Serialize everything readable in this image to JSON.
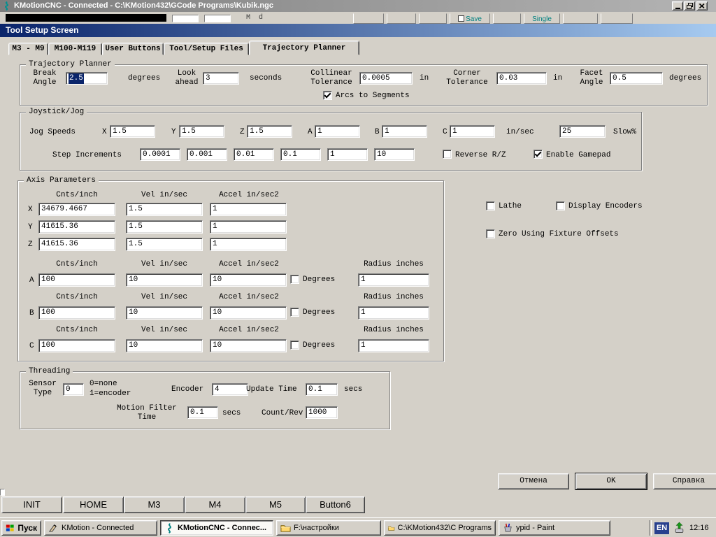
{
  "colors": {
    "face": "#d4d0c8",
    "selection": "#0a246a",
    "titlebar_active_start": "#0a246a",
    "titlebar_active_end": "#a6caf0",
    "teal_accent": "#008080",
    "lang_badge": "#28408e"
  },
  "window": {
    "title": "KMotionCNC - Connected - C:\\KMotion432\\GCode Programs\\Kubik.ngc"
  },
  "strip": {
    "machine_fragment": "M  d",
    "buttons": [
      {
        "label": ""
      },
      {
        "label": ""
      },
      {
        "label": ""
      },
      {
        "label": "Save"
      },
      {
        "label": ""
      },
      {
        "label": "Single"
      },
      {
        "label": ""
      },
      {
        "label": ""
      }
    ]
  },
  "dialog": {
    "title": "Tool Setup Screen",
    "tabs": [
      {
        "label": "M3 - M9"
      },
      {
        "label": "M100-M119"
      },
      {
        "label": "User Buttons"
      },
      {
        "label": "Tool/Setup Files"
      },
      {
        "label": "Trajectory Planner"
      }
    ],
    "trajectory": {
      "group_label": "Trajectory Planner",
      "break_angle": {
        "l1": "Break",
        "l2": "Angle",
        "value": "2.5",
        "unit": "degrees"
      },
      "look_ahead": {
        "l1": "Look",
        "l2": "ahead",
        "value": "3",
        "unit": "seconds"
      },
      "collinear": {
        "l1": "Collinear",
        "l2": "Tolerance",
        "value": "0.0005",
        "unit": "in"
      },
      "corner": {
        "l1": "Corner",
        "l2": "Tolerance",
        "value": "0.03",
        "unit": "in"
      },
      "facet": {
        "l1": "Facet",
        "l2": "Angle",
        "value": "0.5",
        "unit": "degrees"
      },
      "arcs_label": "Arcs to Segments"
    },
    "joystick": {
      "group_label": "Joystick/Jog",
      "jog_label": "Jog Speeds",
      "axes": [
        {
          "axis": "X",
          "value": "1.5"
        },
        {
          "axis": "Y",
          "value": "1.5"
        },
        {
          "axis": "Z",
          "value": "1.5"
        },
        {
          "axis": "A",
          "value": "1"
        },
        {
          "axis": "B",
          "value": "1"
        },
        {
          "axis": "C",
          "value": "1"
        }
      ],
      "unit": "in/sec",
      "slow_value": "25",
      "slow_label": "Slow%",
      "step_label": "Step Increments",
      "steps": [
        "0.0001",
        "0.001",
        "0.01",
        "0.1",
        "1",
        "10"
      ],
      "reverse_label": "Reverse R/Z",
      "gamepad_label": "Enable Gamepad"
    },
    "axis": {
      "group_label": "Axis Parameters",
      "headers": {
        "cnts": "Cnts/inch",
        "vel": "Vel in/sec",
        "accel": "Accel in/sec2",
        "radius": "Radius inches"
      },
      "degrees_label": "Degrees",
      "linear": [
        {
          "axis": "X",
          "cnts": "34679.4667",
          "vel": "1.5",
          "accel": "1"
        },
        {
          "axis": "Y",
          "cnts": "41615.36",
          "vel": "1.5",
          "accel": "1"
        },
        {
          "axis": "Z",
          "cnts": "41615.36",
          "vel": "1.5",
          "accel": "1"
        }
      ],
      "rotary": [
        {
          "axis": "A",
          "cnts": "100",
          "vel": "10",
          "accel": "10",
          "radius": "1"
        },
        {
          "axis": "B",
          "cnts": "100",
          "vel": "10",
          "accel": "10",
          "radius": "1"
        },
        {
          "axis": "C",
          "cnts": "100",
          "vel": "10",
          "accel": "10",
          "radius": "1"
        }
      ]
    },
    "options": {
      "lathe": "Lathe",
      "display_encoders": "Display Encoders",
      "zero_fixture": "Zero Using Fixture Offsets"
    },
    "threading": {
      "group_label": "Threading",
      "sensor": {
        "l1": "Sensor",
        "l2": "Type",
        "value": "0",
        "hint1": "0=none",
        "hint2": "1=encoder"
      },
      "encoder_label": "Encoder",
      "encoder_value": "4",
      "update_label": "Update Time",
      "update_value": "0.1",
      "update_unit": "secs",
      "filter_l1": "Motion Filter",
      "filter_l2": "Time",
      "filter_value": "0.1",
      "filter_unit": "secs",
      "count_label": "Count/Rev",
      "count_value": "1000"
    },
    "buttons": {
      "cancel": "Отмена",
      "ok": "OK",
      "help": "Справка"
    }
  },
  "user_buttons": [
    {
      "label": "INIT"
    },
    {
      "label": "HOME"
    },
    {
      "label": "M3"
    },
    {
      "label": "M4"
    },
    {
      "label": "M5"
    },
    {
      "label": "Button6"
    }
  ],
  "taskbar": {
    "start": "Пуск",
    "tasks": [
      {
        "label": "KMotion - Connected"
      },
      {
        "label": "KMotionCNC - Connec..."
      },
      {
        "label": "F:\\настройки"
      },
      {
        "label": "C:\\KMotion432\\C Programs"
      },
      {
        "label": "ypid - Paint"
      }
    ],
    "lang": "EN",
    "time": "12:16"
  }
}
